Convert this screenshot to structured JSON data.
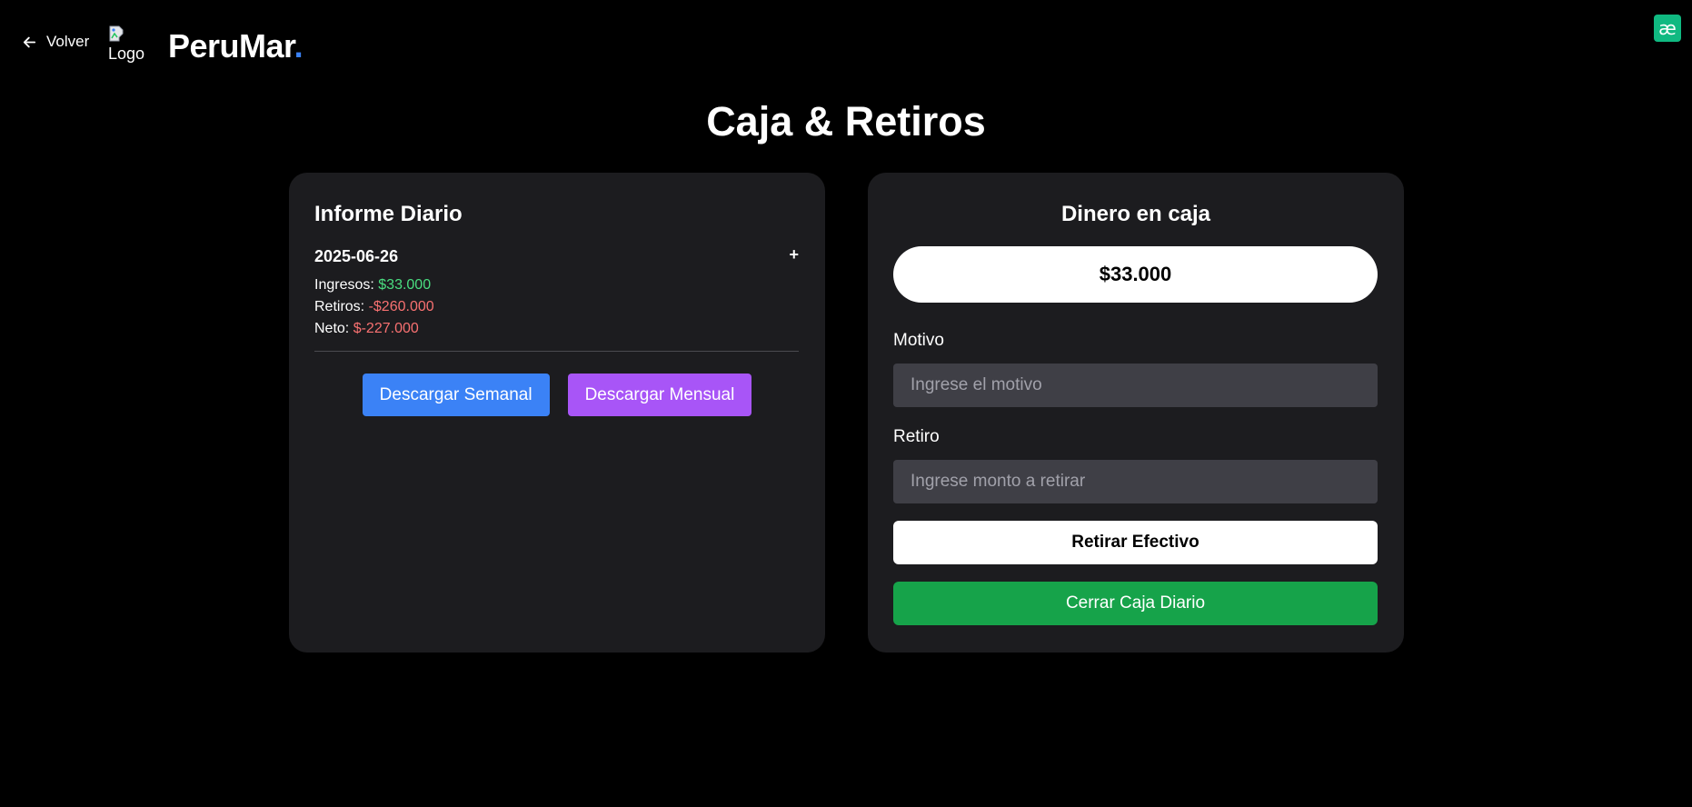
{
  "header": {
    "back_label": "Volver",
    "logo_alt": "Logo",
    "brand_name": "PeruMar",
    "brand_dot": ".",
    "corner_badge": "æ"
  },
  "page_title": "Caja & Retiros",
  "daily_report": {
    "title": "Informe Diario",
    "entries": [
      {
        "date": "2025-06-26",
        "expand_symbol": "+",
        "income_label": "Ingresos:",
        "income_value": "$33.000",
        "withdrawals_label": "Retiros:",
        "withdrawals_value": "-$260.000",
        "net_label": "Neto:",
        "net_value": "$-227.000"
      }
    ],
    "download_weekly_label": "Descargar Semanal",
    "download_monthly_label": "Descargar Mensual"
  },
  "cash_box": {
    "title": "Dinero en caja",
    "amount": "$33.000",
    "reason_label": "Motivo",
    "reason_placeholder": "Ingrese el motivo",
    "reason_value": "",
    "withdraw_label": "Retiro",
    "withdraw_placeholder": "Ingrese monto a retirar",
    "withdraw_value": "",
    "withdraw_button": "Retirar Efectivo",
    "close_button": "Cerrar Caja Diario"
  },
  "colors": {
    "background": "#000000",
    "card": "#1c1c1f",
    "positive": "#4ade80",
    "negative": "#f87171",
    "brand_accent": "#3b82f6",
    "weekly_button": "#3b82f6",
    "monthly_button": "#a855f7",
    "close_button": "#16a34a",
    "badge": "#10b981"
  },
  "icons": {
    "back": "arrow-left-icon",
    "logo": "broken-image-icon",
    "badge": "extension-icon"
  }
}
